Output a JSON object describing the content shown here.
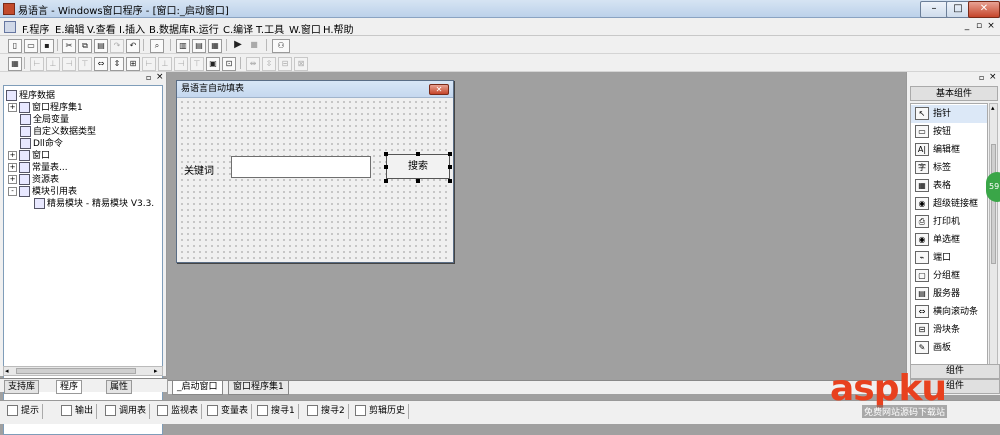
{
  "window": {
    "title": "易语言 - Windows窗口程序 - [窗口:_启动窗口]"
  },
  "menu": {
    "items": [
      "F.程序",
      "E.编辑",
      "V.查看",
      "I.插入",
      "B.数据库",
      "R.运行",
      "C.编译",
      "T.工具",
      "W.窗口",
      "H.帮助"
    ]
  },
  "left_panel": {
    "tree": [
      {
        "label": "程序数据",
        "level": 0,
        "icon": "database-icon"
      },
      {
        "label": "窗口程序集1",
        "level": 1,
        "icon": "module-icon",
        "expand": "+"
      },
      {
        "label": "全局变量",
        "level": 1,
        "icon": "variable-icon"
      },
      {
        "label": "自定义数据类型",
        "level": 1,
        "icon": "type-icon"
      },
      {
        "label": "Dll命令",
        "level": 1,
        "icon": "dll-icon"
      },
      {
        "label": "窗口",
        "level": 1,
        "icon": "window-icon",
        "expand": "+"
      },
      {
        "label": "常量表...",
        "level": 1,
        "icon": "constant-icon",
        "expand": "+"
      },
      {
        "label": "资源表",
        "level": 1,
        "icon": "resource-icon",
        "expand": "+"
      },
      {
        "label": "模块引用表",
        "level": 1,
        "icon": "module-ref-icon",
        "expand": "-"
      },
      {
        "label": "精易模块 - 精易模块 V3.3.",
        "level": 2,
        "icon": "module-file-icon"
      }
    ],
    "tabs": [
      "支持库",
      "程序",
      "属性"
    ]
  },
  "form": {
    "title": "易语言自动填表",
    "label": "关键词",
    "input_value": "",
    "button": "搜索"
  },
  "doc_tabs": [
    "_启动窗口",
    "窗口程序集1"
  ],
  "components": {
    "header": "基本组件",
    "items": [
      {
        "label": "指针",
        "icon": "pointer-icon",
        "glyph": "↖"
      },
      {
        "label": "按钮",
        "icon": "button-icon",
        "glyph": "▭"
      },
      {
        "label": "编辑框",
        "icon": "editbox-icon",
        "glyph": "A|"
      },
      {
        "label": "标签",
        "icon": "label-icon",
        "glyph": "字"
      },
      {
        "label": "表格",
        "icon": "table-icon",
        "glyph": "▦"
      },
      {
        "label": "超级链接框",
        "icon": "hyperlink-icon",
        "glyph": "◉"
      },
      {
        "label": "打印机",
        "icon": "printer-icon",
        "glyph": "⎙"
      },
      {
        "label": "单选框",
        "icon": "radio-icon",
        "glyph": "◉"
      },
      {
        "label": "端口",
        "icon": "port-icon",
        "glyph": "⌁"
      },
      {
        "label": "分组框",
        "icon": "groupbox-icon",
        "glyph": "▢"
      },
      {
        "label": "服务器",
        "icon": "server-icon",
        "glyph": "▤"
      },
      {
        "label": "横向滚动条",
        "icon": "hscroll-icon",
        "glyph": "⇔"
      },
      {
        "label": "滑块条",
        "icon": "slider-icon",
        "glyph": "⊟"
      },
      {
        "label": "画板",
        "icon": "canvas-icon",
        "glyph": "✎"
      }
    ],
    "cat1": "组件",
    "cat2": "组件"
  },
  "status_tabs": [
    "提示",
    "输出",
    "调用表",
    "监视表",
    "变量表",
    "搜寻1",
    "搜寻2",
    "剪辑历史"
  ],
  "watermark": {
    "text": "aspku",
    "sub": "免费网站源码下载站",
    "badge": "59"
  }
}
